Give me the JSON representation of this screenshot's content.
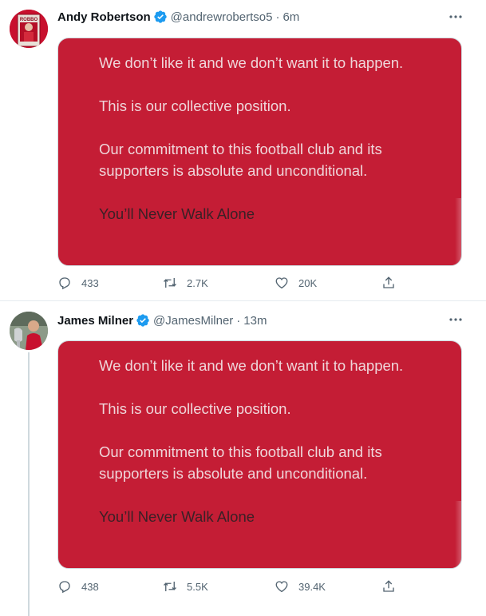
{
  "tweets": [
    {
      "name": "Andy Robertson",
      "handle": "@andrewrobertso5",
      "time": "6m",
      "avatar_text": "ROBBO",
      "image_text": [
        "We don’t like it and we don’t want it to happen.",
        "This is our collective position.",
        "Our commitment to this football club and its",
        "supporters is absolute and unconditional.",
        "You’ll Never Walk Alone"
      ],
      "replies": "433",
      "retweets": "2.7K",
      "likes": "20K"
    },
    {
      "name": "James Milner",
      "handle": "@JamesMilner",
      "time": "13m",
      "image_text": [
        "We don’t like it and we don’t want it to happen.",
        "This is our collective position.",
        "Our commitment to this football club and its",
        "supporters is absolute and unconditional.",
        "You’ll Never Walk Alone"
      ],
      "replies": "438",
      "retweets": "5.5K",
      "likes": "39.4K"
    }
  ],
  "separator": "·",
  "colors": {
    "verified": "#1d9bf0",
    "card": "#c41d35",
    "muted": "#536471"
  },
  "icons": [
    "verified-icon",
    "more-icon",
    "reply-icon",
    "retweet-icon",
    "like-icon",
    "share-icon"
  ]
}
